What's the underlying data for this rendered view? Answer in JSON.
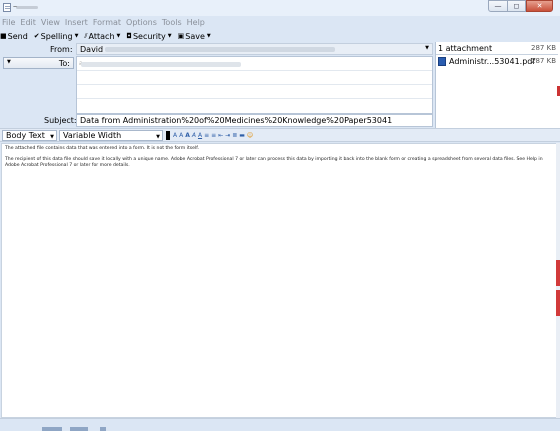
{
  "window": {
    "title": "———",
    "min_glyph": "—",
    "max_glyph": "◻",
    "close_glyph": "✕"
  },
  "menu": [
    "File",
    "Edit",
    "View",
    "Insert",
    "Format",
    "Options",
    "Tools",
    "Help"
  ],
  "toolbar": {
    "send": "Send",
    "spelling": "Spelling",
    "attach": "Attach",
    "security": "Security",
    "save": "Save"
  },
  "header": {
    "from_label": "From:",
    "from_value": "David",
    "to_label": "To:",
    "recipient_placeholder": "a",
    "subject_label": "Subject:",
    "subject_value": "Data from Administration%20of%20Medicines%20Knowledge%20Paper53041"
  },
  "attachments": {
    "header_label": "1 attachment",
    "header_size": "287 KB",
    "items": [
      {
        "name": "Administr...53041.pdf",
        "size": "287 KB",
        "icon": "pdf-icon"
      }
    ]
  },
  "format_bar": {
    "paragraph_style": "Body Text",
    "font_name": "Variable Width",
    "tools": [
      "A",
      "A",
      "A",
      "A",
      "A",
      "≡",
      "≡",
      "⇤",
      "⇥",
      "≣",
      "▬",
      "☺"
    ]
  },
  "body": {
    "paragraphs": [
      "The attached file contains data that was entered into a form. It is not the form itself.",
      "The recipient of this data file should save it locally with a unique name. Adobe Acrobat Professional 7 or later can process this data by importing it back into the blank form or creating a spreadsheet from several data files. See Help in Adobe Acrobat Professional 7 or later for more details."
    ]
  },
  "colors": {
    "chrome": "#dbe6f4",
    "accent": "#2f5fa8",
    "close": "#c8503a"
  }
}
